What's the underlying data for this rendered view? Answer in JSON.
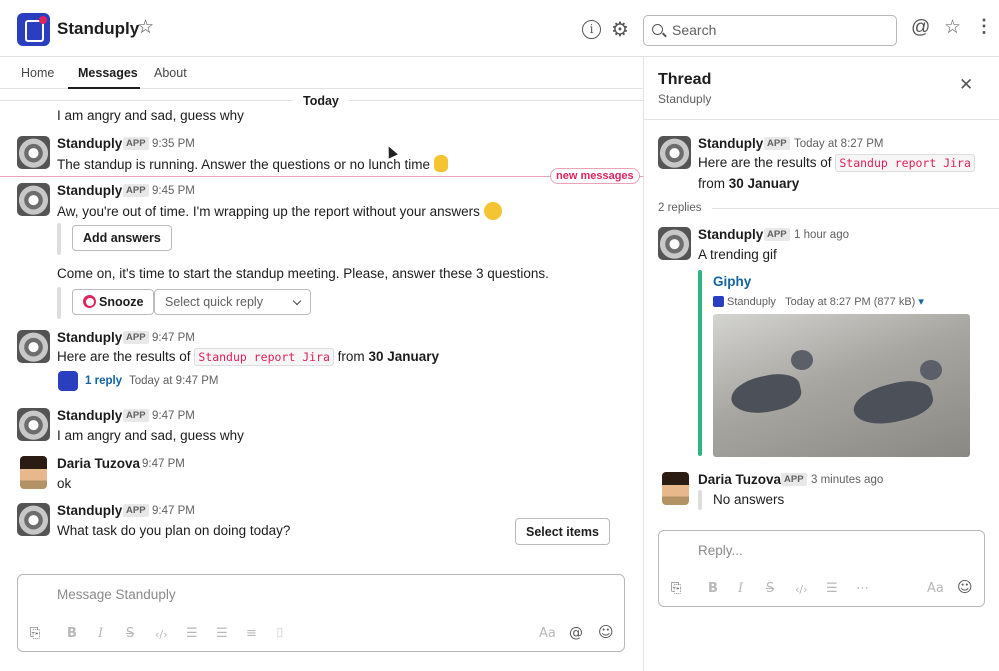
{
  "header": {
    "title": "Standuply",
    "search_placeholder": "Search",
    "icons": [
      "star-icon",
      "info-icon",
      "gear-icon",
      "search-icon",
      "at-icon",
      "star-icon",
      "kebab-icon"
    ]
  },
  "tabs": [
    {
      "label": "Home"
    },
    {
      "label": "Messages",
      "active": true
    },
    {
      "label": "About"
    }
  ],
  "day_divider": "Today",
  "new_messages_label": "new messages",
  "app_badge": "APP",
  "messages": [
    {
      "text": "I am angry and sad, guess why"
    },
    {
      "sender": "Standuply",
      "time": "9:35 PM",
      "text": "The standup is running. Answer the questions or no lunch time"
    },
    {
      "sender": "Standuply",
      "time": "9:45 PM",
      "text": "Aw, you're out of time. I'm wrapping up the report without your answers",
      "button": "Add answers"
    },
    {
      "text": "Come on, it's time to start the standup meeting. Please, answer these 3 questions.",
      "button": "Snooze",
      "select_placeholder": "Select quick reply"
    },
    {
      "sender": "Standuply",
      "time": "9:47 PM",
      "text_prefix": "Here are the results of",
      "code": "Standup report Jira",
      "text_suffix": "from",
      "date": "30 January",
      "reply_count": "1 reply",
      "reply_time": "Today at 9:47 PM"
    },
    {
      "sender": "Standuply",
      "time": "9:47 PM",
      "text": "I am angry and sad, guess why"
    },
    {
      "sender": "Daria Tuzova",
      "time": "9:47 PM",
      "text": "ok"
    },
    {
      "sender": "Standuply",
      "time": "9:47 PM",
      "text": "What task do you plan on doing today?",
      "button": "Select items"
    }
  ],
  "composer": {
    "placeholder": "Message Standuply",
    "aa": "Aa"
  },
  "thread": {
    "title": "Thread",
    "subtitle": "Standuply",
    "root": {
      "sender": "Standuply",
      "time": "Today at 8:27 PM",
      "text_prefix": "Here are the results of",
      "code": "Standup report Jira",
      "text_suffix": "from",
      "date": "30 January"
    },
    "replies_label": "2 replies",
    "reply1": {
      "sender": "Standuply",
      "time": "1 hour ago",
      "text": "A trending gif",
      "giphy_title": "Giphy",
      "giphy_source": "Standuply",
      "giphy_meta": "Today at 8:27 PM (877 kB)"
    },
    "reply2": {
      "sender": "Daria Tuzova",
      "time": "3 minutes ago",
      "text": "No answers"
    },
    "reply_placeholder": "Reply...",
    "aa": "Aa"
  }
}
